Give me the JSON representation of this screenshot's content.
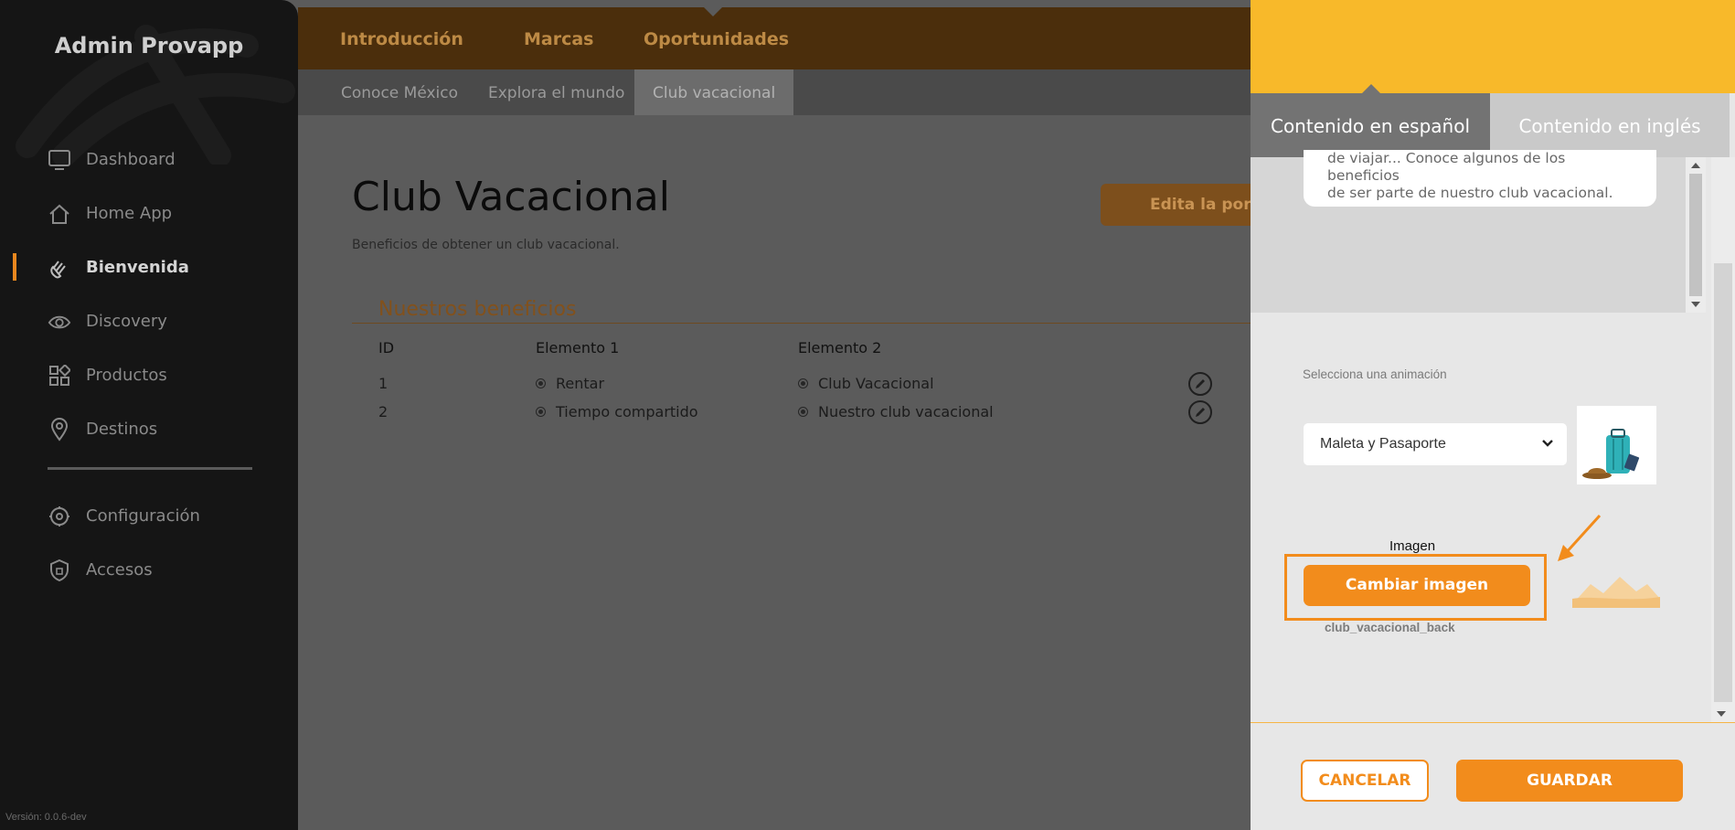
{
  "sidebar": {
    "brand": "Admin Provapp",
    "items": [
      {
        "label": "Dashboard",
        "icon": "monitor-icon"
      },
      {
        "label": "Home App",
        "icon": "home-icon"
      },
      {
        "label": "Bienvenida",
        "icon": "wave-hand-icon"
      },
      {
        "label": "Discovery",
        "icon": "eye-icon"
      },
      {
        "label": "Productos",
        "icon": "grid-icon"
      },
      {
        "label": "Destinos",
        "icon": "pin-icon"
      }
    ],
    "items2": [
      {
        "label": "Configuración",
        "icon": "gear-icon"
      },
      {
        "label": "Accesos",
        "icon": "shield-icon"
      }
    ],
    "version": "Versión: 0.0.6-dev"
  },
  "topnav": {
    "tabs": [
      "Introducción",
      "Marcas",
      "Oportunidades"
    ]
  },
  "subnav": {
    "tabs": [
      "Conoce México",
      "Explora el mundo",
      "Club vacacional"
    ]
  },
  "main": {
    "title": "Club Vacacional",
    "subtitle": "Beneficios de obtener un club vacacional.",
    "edit_button": "Edita la port",
    "section_title": "Nuestros beneficios",
    "table": {
      "headers": [
        "ID",
        "Elemento 1",
        "Elemento 2"
      ],
      "rows": [
        {
          "id": "1",
          "e1": "Rentar",
          "e2": "Club Vacacional"
        },
        {
          "id": "2",
          "e1": "Tiempo compartido",
          "e2": "Nuestro club vacacional"
        }
      ]
    }
  },
  "panel": {
    "tab_es": "Contenido en español",
    "tab_en": "Contenido en inglés",
    "text_line1": "de viajar... Conoce algunos de los beneficios",
    "text_line2": "de ser parte de nuestro club vacacional.",
    "anim_label": "Selecciona una animación",
    "anim_value": "Maleta y Pasaporte",
    "image_label": "Imagen",
    "change_image": "Cambiar imagen",
    "filename": "club_vacacional_back",
    "cancel": "CANCELAR",
    "save": "GUARDAR"
  },
  "colors": {
    "accent": "#f28c1c",
    "header_yellow": "#f8b92a",
    "sidebar_bg": "#151515"
  }
}
